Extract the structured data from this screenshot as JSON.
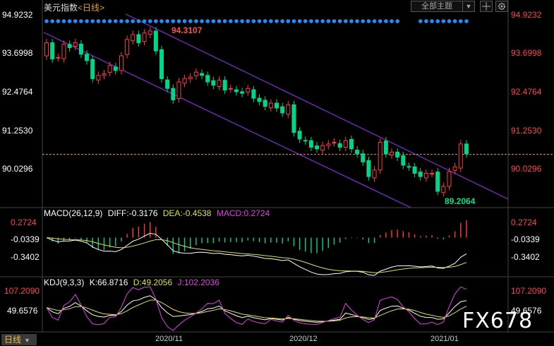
{
  "header": {
    "symbol": "美元指数",
    "period": "<日线>",
    "theme_button": "全部主题",
    "theme_arrow": "▼"
  },
  "colors": {
    "up": "#ff3b3b",
    "down": "#00d68a",
    "channel": "#8a2be2",
    "price_label_left": "#ffffff",
    "price_label_right": "#ff4444",
    "dots": "#1e90ff",
    "last_price_line": "#e0a030",
    "diff": "#ffffff",
    "dea": "#e0e040",
    "macd_label": "#e040e0",
    "kdj_k": "#ffffff",
    "kdj_d": "#e0e040",
    "kdj_j": "#e040e0"
  },
  "main_panel": {
    "price_levels": [
      "94.9232",
      "93.6998",
      "92.4764",
      "91.2530",
      "90.0296"
    ],
    "high_label": "94.3107",
    "low_label": "89.2064",
    "last_price": 90.53
  },
  "macd_panel": {
    "title": "MACD(26,12,9)",
    "diff": "DIFF:-0.3176",
    "dea": "DEA:-0.4538",
    "macd": "MACD:0.2724",
    "levels": [
      "0.2724",
      "-0.0339",
      "-0.3402"
    ]
  },
  "kdj_panel": {
    "title": "KDJ(9,3,3)",
    "k": "K:66.8716",
    "d": "D:49.2056",
    "j": "J:102.2036",
    "levels": [
      "107.2090",
      "49.6576"
    ]
  },
  "x_axis": {
    "ticks": [
      {
        "label": "2020/11",
        "index": 26
      },
      {
        "label": "2020/12",
        "index": 47
      },
      {
        "label": "2021/01",
        "index": 69
      }
    ]
  },
  "footer": {
    "timeframe": "日线",
    "watermark": "FX678"
  },
  "chart_data": {
    "type": "candlestick",
    "title": "美元指数 <日线>",
    "y_range": [
      88.9,
      95.0
    ],
    "closes": [
      93.95,
      93.45,
      93.5,
      93.9,
      93.8,
      93.95,
      93.6,
      93.4,
      92.85,
      92.95,
      93.0,
      93.25,
      93.1,
      93.55,
      94.05,
      94.2,
      93.95,
      94.25,
      94.31,
      93.7,
      92.85,
      92.55,
      92.2,
      92.75,
      92.85,
      92.9,
      93.05,
      92.95,
      92.75,
      92.65,
      92.8,
      92.5,
      92.55,
      92.45,
      92.4,
      92.55,
      92.25,
      92.15,
      92.0,
      92.1,
      91.95,
      91.8,
      92.05,
      91.2,
      91.0,
      90.95,
      90.75,
      90.7,
      90.8,
      90.85,
      90.9,
      90.75,
      90.95,
      90.7,
      90.55,
      90.3,
      89.85,
      90.05,
      90.9,
      90.55,
      90.6,
      90.45,
      90.2,
      90.15,
      89.95,
      89.85,
      89.95,
      89.95,
      89.4,
      89.55,
      90.0,
      90.15,
      90.85,
      90.55
    ],
    "highs_lows": {
      "high": 94.3107,
      "low": 89.2064
    }
  }
}
